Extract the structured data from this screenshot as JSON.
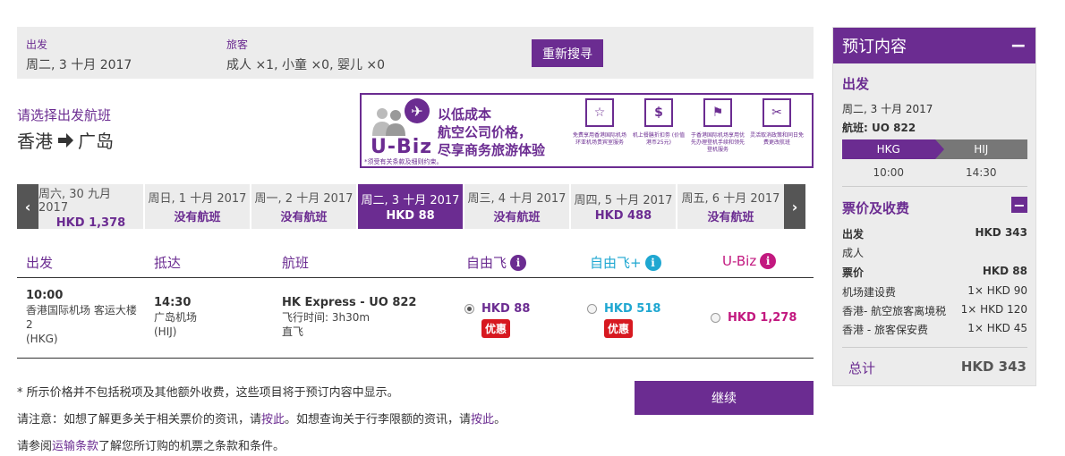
{
  "search": {
    "depart_label": "出发",
    "depart_value": "周二, 3 十月 2017",
    "pax_label": "旅客",
    "pax_value": "成人 ×1, 小童 ×0, 婴儿 ×0",
    "research_button": "重新搜寻"
  },
  "route": {
    "select_label": "请选择出发航班",
    "origin": "香港",
    "destination": "广岛"
  },
  "banner": {
    "logo": "U-Biz",
    "headline_1": "以低成本",
    "headline_2": "航空公司价格，",
    "headline_3": "尽享商务旅游体验",
    "footnote": "*须受有关条款及细则约束。",
    "features": [
      {
        "icon": "lounge-icon",
        "symbol": "☆",
        "text": "免费享用香港国际机场环亚机场贵宾室服务"
      },
      {
        "icon": "voucher-icon",
        "symbol": "$",
        "text": "机上餐膳折扣劵 (价值港币25元)"
      },
      {
        "icon": "priority-icon",
        "symbol": "⚑",
        "text": "于香港国际机场享用优先办理登机手续和领先登机服务"
      },
      {
        "icon": "flexibility-icon",
        "symbol": "✂",
        "text": "灵活取消政策和同日免费更改航班"
      }
    ],
    "brand_color": "#6b2c91"
  },
  "dates": [
    {
      "date": "周六, 30 九月 2017",
      "price": "HKD 1,378",
      "active": false
    },
    {
      "date": "周日, 1 十月 2017",
      "price": "没有航班",
      "active": false
    },
    {
      "date": "周一, 2 十月 2017",
      "price": "没有航班",
      "active": false
    },
    {
      "date": "周二, 3 十月 2017",
      "price": "HKD 88",
      "active": true
    },
    {
      "date": "周三, 4 十月 2017",
      "price": "没有航班",
      "active": false
    },
    {
      "date": "周四, 5 十月 2017",
      "price": "HKD 488",
      "active": false
    },
    {
      "date": "周五, 6 十月 2017",
      "price": "没有航班",
      "active": false
    }
  ],
  "table": {
    "headers": {
      "depart": "出发",
      "arrive": "抵达",
      "flight": "航班",
      "fare1": "自由飞",
      "fare2": "自由飞+",
      "fare3": "U-Biz"
    },
    "row": {
      "dep_time": "10:00",
      "dep_airport": "香港国际机场 客运大楼 2",
      "dep_code": "(HKG)",
      "arr_time": "14:30",
      "arr_airport": "广岛机场",
      "arr_code": "(HIJ)",
      "flight_no": "HK Express - UO 822",
      "duration_label": "飞行时间:",
      "duration": "3h30m",
      "stops": "直飞",
      "fare1_price": "HKD 88",
      "fare2_price": "HKD 518",
      "fare3_price": "HKD 1,278",
      "promo": "优惠"
    },
    "colors": {
      "fare1": "#6b2c91",
      "fare2": "#1fa7d1",
      "fare3": "#c2187f",
      "promo": "#d71920"
    }
  },
  "notes": {
    "line1": "* 所示价格并不包括税项及其他额外收费，这些项目将于预订内容中显示。",
    "line2_a": "请注意：如想了解更多关于相关票价的资讯，请",
    "line2_link1": "按此",
    "line2_b": "。如想查询关于行李限额的资讯，请",
    "line2_link2": "按此",
    "line2_c": "。",
    "line3_a": "请参阅",
    "line3_link": "运输条款",
    "line3_b": "了解您所订购的机票之条款和条件。",
    "continue_button": "继续"
  },
  "sidebar": {
    "title": "预订内容",
    "depart_heading": "出发",
    "date": "周二, 3 十月 2017",
    "flight_label": "航班:",
    "flight_no": "UO 822",
    "from": "HKG",
    "to": "HIJ",
    "dep_time": "10:00",
    "arr_time": "14:30",
    "fare_heading": "票价及收费",
    "depart_label": "出发",
    "depart_total": "HKD 343",
    "adult": "成人",
    "fare_label": "票价",
    "fare_value": "HKD 88",
    "fees": [
      {
        "label": "机场建设费",
        "value": "1× HKD 90"
      },
      {
        "label": "香港- 航空旅客离境税",
        "value": "1× HKD 120"
      },
      {
        "label": "香港 - 旅客保安费",
        "value": "1× HKD 45"
      }
    ],
    "total_label": "总计",
    "total_value": "HKD 343"
  }
}
